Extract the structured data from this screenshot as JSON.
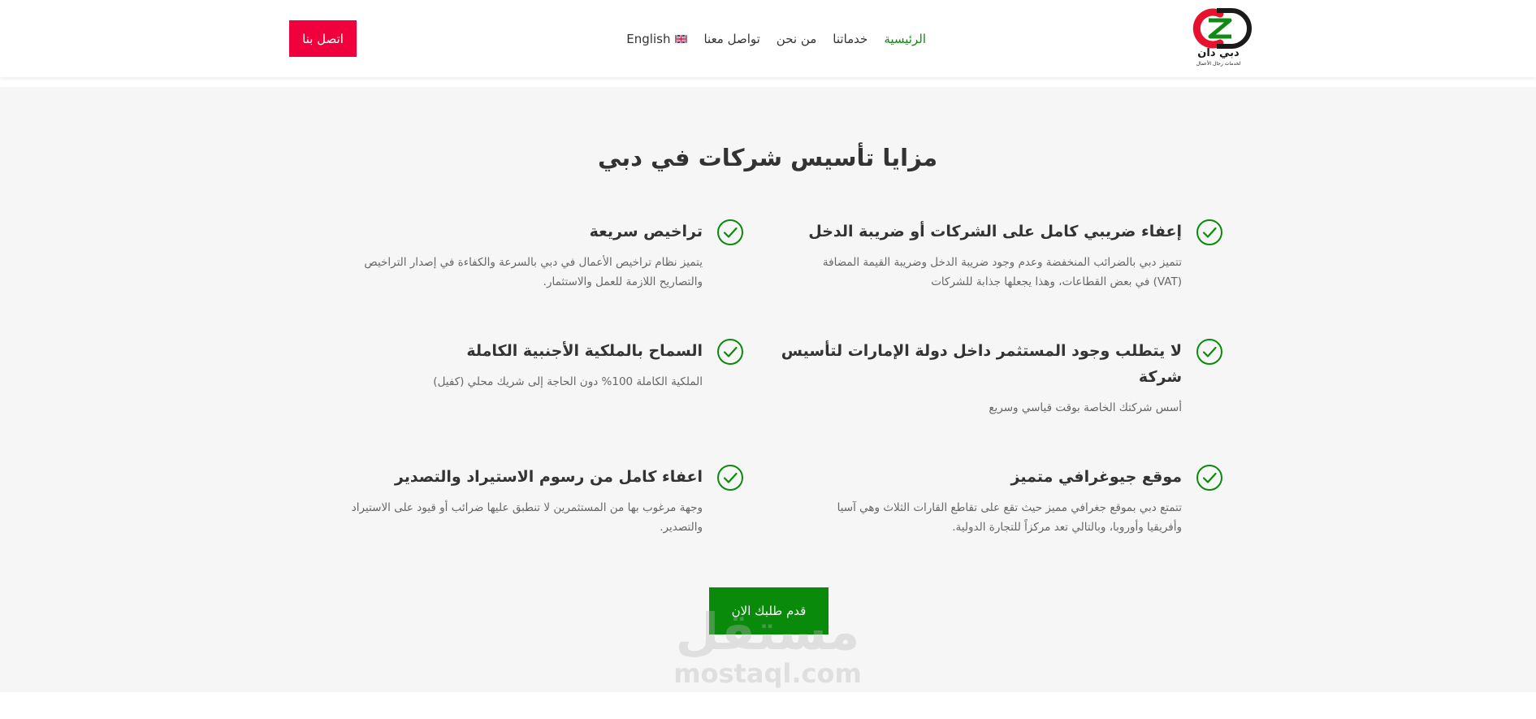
{
  "colors": {
    "accent_green": "#0a8a0a",
    "nav_active": "#0f8a12",
    "contact_red": "#f0003c",
    "section_bg": "#f6f6f6",
    "text_dark": "#333333",
    "text_muted": "#666666"
  },
  "header": {
    "logo": {
      "icon": "cd-logo-icon",
      "text": "دبي دان",
      "subtext": "لخدمات رجال الأعمال"
    },
    "nav": {
      "home": "الرئيسية",
      "services": "خدماتنا",
      "about": "من نحن",
      "contact": "تواصل معنا",
      "language": "English",
      "language_icon": "uk-flag-icon"
    },
    "contact_button": "اتصل بنا"
  },
  "section": {
    "title": "مزايا تأسيس شركات في دبي",
    "features": [
      {
        "icon": "check-circle-icon",
        "title": "إعفاء ضريبي كامل على الشركات أو ضريبة الدخل",
        "desc_line1": "تتميز دبي بالضرائب المنخفضة وعدم وجود ضريبة الدخل وضريبة القيمة المضافة",
        "desc_line2": "(VAT) في بعض القطاعات، وهذا يجعلها جذابة للشركات"
      },
      {
        "icon": "check-circle-icon",
        "title": "تراخيص سريعة",
        "desc_line1": "يتميز نظام تراخيص الأعمال في دبي بالسرعة والكفاءة في إصدار التراخيص",
        "desc_line2": "والتصاريح اللازمة للعمل والاستثمار."
      },
      {
        "icon": "check-circle-icon",
        "title_line1": "لا يتطلب وجود المستثمر داخل دولة الإمارات لتأسيس",
        "title_line2": "شركة",
        "desc_line1": "أسس شركتك الخاصة بوقت قياسي وسريع"
      },
      {
        "icon": "check-circle-icon",
        "title": "السماح بالملكية الأجنبية الكاملة",
        "desc_line1": "الملكية الكاملة 100% دون الحاجة إلى شريك محلي (كفيل)"
      },
      {
        "icon": "check-circle-icon",
        "title": "موقع جيوغرافي متميز",
        "desc_line1": "تتمتع دبي بموقع جغرافي مميز حيث تقع على تقاطع القارات الثلاث وهي آسيا",
        "desc_line2": "وأفريقيا وأوروبا، وبالتالي تعد مركزاً للتجارة الدولية."
      },
      {
        "icon": "check-circle-icon",
        "title": "اعفاء كامل من رسوم الاستيراد والتصدير",
        "desc_line1": "وجهة مرغوب بها من المستثمرين لا تنطبق عليها ضرائب أو قيود على الاستيراد",
        "desc_line2": "والتصدير."
      }
    ],
    "apply_button": "قدم طلبك الان"
  },
  "watermark": {
    "arabic": "مستقل",
    "english": "mostaql.com"
  }
}
